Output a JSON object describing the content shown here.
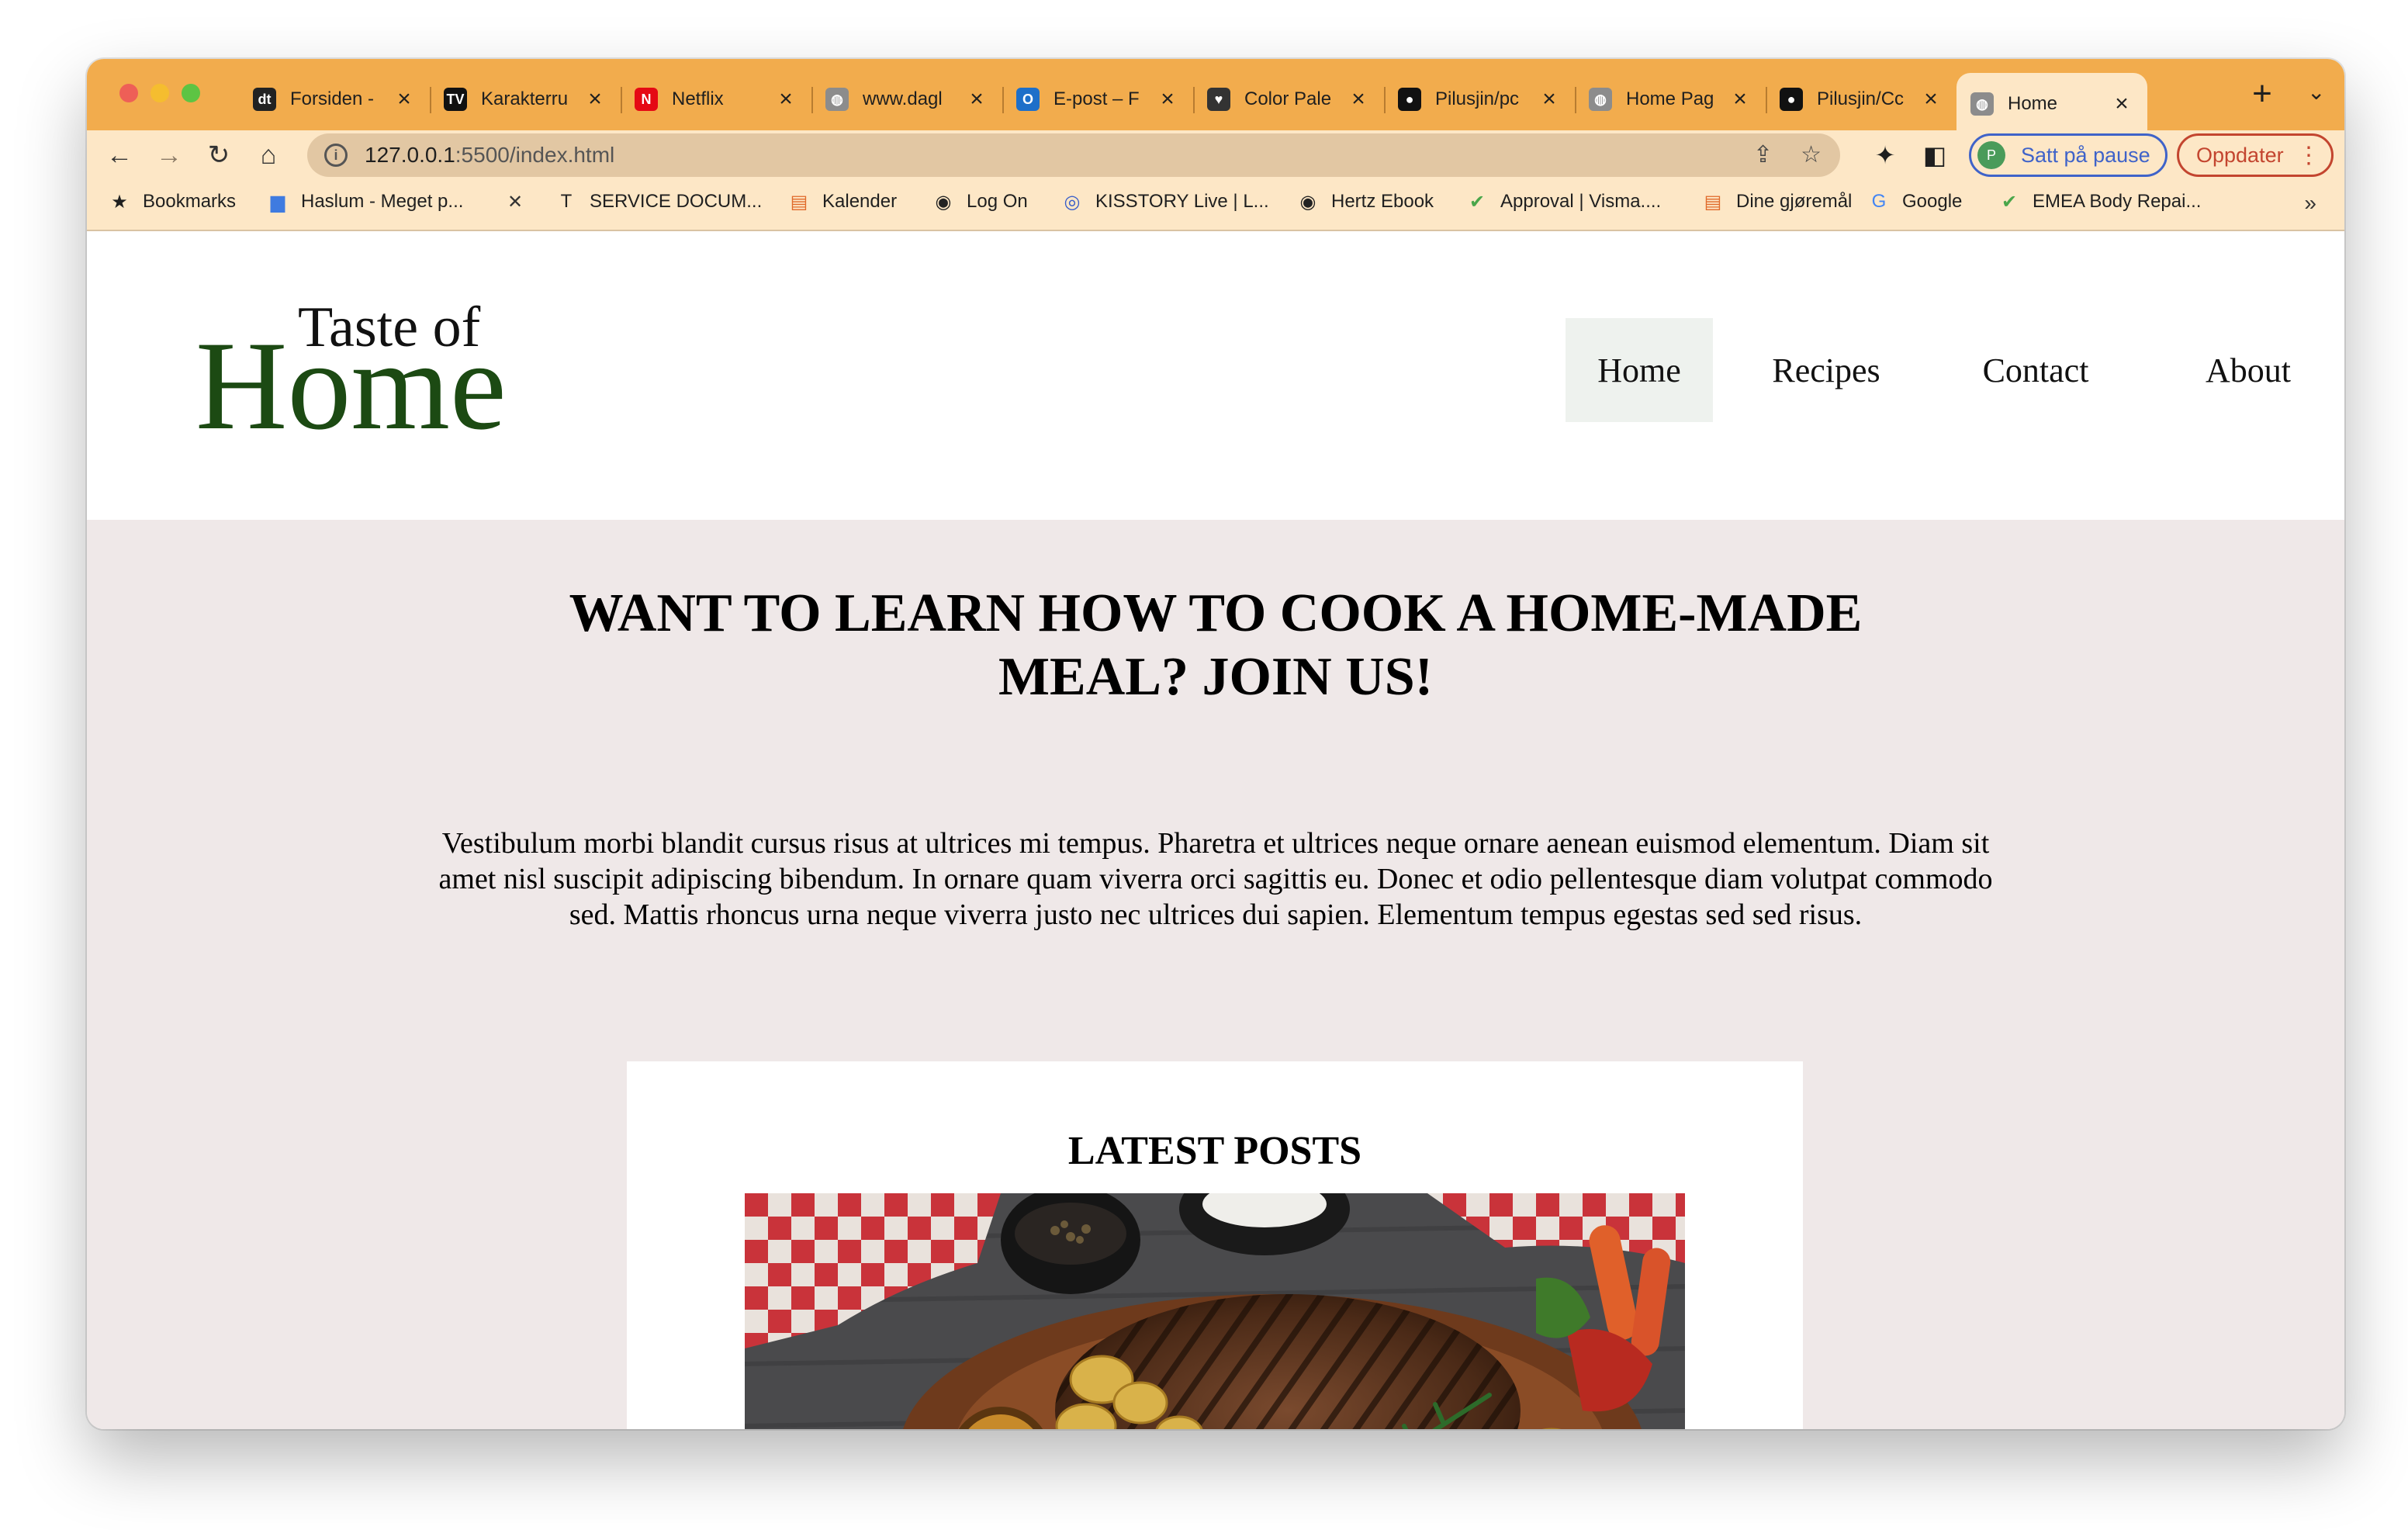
{
  "browser": {
    "tabs": [
      {
        "title": "Forsiden - ",
        "favicon": "dn-icon",
        "favicon_color": "#222222",
        "favicon_glyph": "dt"
      },
      {
        "title": "Karakterru",
        "favicon": "tv-icon",
        "favicon_color": "#111111",
        "favicon_glyph": "TV"
      },
      {
        "title": "Netflix",
        "favicon": "netflix-icon",
        "favicon_color": "#e50914",
        "favicon_glyph": "N"
      },
      {
        "title": "www.dagl",
        "favicon": "globe-icon",
        "favicon_color": "#8c8c8c",
        "favicon_glyph": "◍"
      },
      {
        "title": "E-post – F",
        "favicon": "outlook-icon",
        "favicon_color": "#1e6fc9",
        "favicon_glyph": "O"
      },
      {
        "title": "Color Pale",
        "favicon": "palette-icon",
        "favicon_color": "#333333",
        "favicon_glyph": "♥"
      },
      {
        "title": "Pilusjin/pc",
        "favicon": "github-icon",
        "favicon_color": "#111111",
        "favicon_glyph": "●"
      },
      {
        "title": "Home Pag",
        "favicon": "globe-icon",
        "favicon_color": "#8c8c8c",
        "favicon_glyph": "◍"
      },
      {
        "title": "Pilusjin/Cc",
        "favicon": "github-icon",
        "favicon_color": "#111111",
        "favicon_glyph": "●"
      },
      {
        "title": "Home",
        "favicon": "globe-icon",
        "favicon_color": "#8c8c8c",
        "favicon_glyph": "◍",
        "active": true
      }
    ],
    "new_tab_label": "+",
    "tab_close_label": "×",
    "url": {
      "host": "127.0.0.1",
      "path": ":5500/index.html"
    },
    "profile_label": "Satt på pause",
    "profile_initial": "P",
    "update_label": "Oppdater",
    "bookmarks": [
      {
        "label": "Bookmarks",
        "icon": "star-icon"
      },
      {
        "label": "Haslum - Meget p...",
        "icon": "folder-icon"
      },
      {
        "label": "",
        "icon": "tools-icon"
      },
      {
        "label": "SERVICE DOCUM...",
        "icon": "tesla-icon"
      },
      {
        "label": "Kalender",
        "icon": "calendar-icon"
      },
      {
        "label": "Log On",
        "icon": "globe-icon"
      },
      {
        "label": "KISSTORY Live | L...",
        "icon": "radio-icon"
      },
      {
        "label": "Hertz Ebook",
        "icon": "globe-icon"
      },
      {
        "label": "Approval | Visma....",
        "icon": "check-icon"
      },
      {
        "label": "Dine gjøremål",
        "icon": "calendar-icon"
      },
      {
        "label": "Google",
        "icon": "google-icon"
      },
      {
        "label": "EMEA Body Repai...",
        "icon": "check-icon"
      }
    ],
    "bookmarks_more": "»",
    "colors": {
      "tabstrip": "#f2ac4d",
      "toolbar": "#fde7c6",
      "omnibox": "#e2c7a3",
      "profile": "#3f63c9",
      "update": "#c3452f"
    }
  },
  "site": {
    "logo_top": "Taste of",
    "logo_main": "Home",
    "logo_color": "#1c4a13",
    "nav": [
      "Home",
      "Recipes",
      "Contact",
      "About"
    ],
    "hero_title": "WANT TO LEARN HOW TO COOK A HOME-MADE MEAL? JOIN US!",
    "hero_text": "Vestibulum morbi blandit cursus risus at ultrices mi tempus. Pharetra et ultrices neque ornare aenean euismod elementum. Diam sit amet nisl suscipit adipiscing bibendum. In ornare quam viverra orci sagittis eu. Donec et odio pellentesque diam volutpat commodo sed. Mattis rhoncus urna neque viverra justo nec ultrices dui sapien. Elementum tempus egestas sed sed risus.",
    "posts_title": "LATEST POSTS",
    "background": "#efe8e8"
  }
}
